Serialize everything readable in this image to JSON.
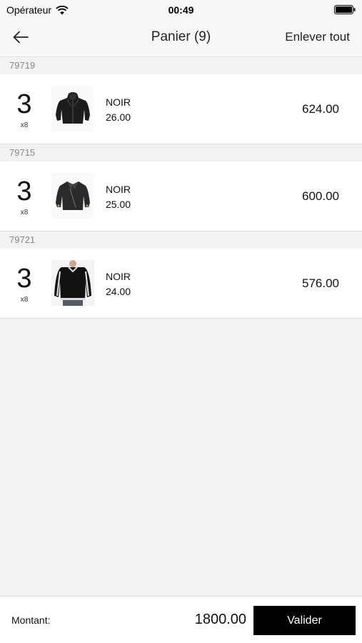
{
  "status_bar": {
    "carrier": "Opérateur",
    "time": "00:49",
    "icons": [
      "wifi-icon",
      "battery-icon"
    ]
  },
  "nav": {
    "back_icon": "arrow-left-icon",
    "title": "Panier (9)",
    "clear_all_label": "Enlever tout"
  },
  "cart": {
    "items": [
      {
        "ref": "79719",
        "quantity": "3",
        "unit": "x8",
        "image": "jacket-hooded-leather-icon",
        "color": "NOIR",
        "unit_price": "26.00",
        "total": "624.00"
      },
      {
        "ref": "79715",
        "quantity": "3",
        "unit": "x8",
        "image": "jacket-leather-biker-icon",
        "color": "NOIR",
        "unit_price": "25.00",
        "total": "600.00"
      },
      {
        "ref": "79721",
        "quantity": "3",
        "unit": "x8",
        "image": "jacket-varsity-model-icon",
        "color": "NOIR",
        "unit_price": "24.00",
        "total": "576.00"
      }
    ]
  },
  "footer": {
    "amount_label": "Montant:",
    "amount_value": "1800.00",
    "validate_label": "Valider"
  },
  "colors": {
    "background": "#f2f2f2",
    "row_background": "#ffffff",
    "button_background": "#000000",
    "button_text": "#ffffff",
    "section_text": "#888888"
  }
}
